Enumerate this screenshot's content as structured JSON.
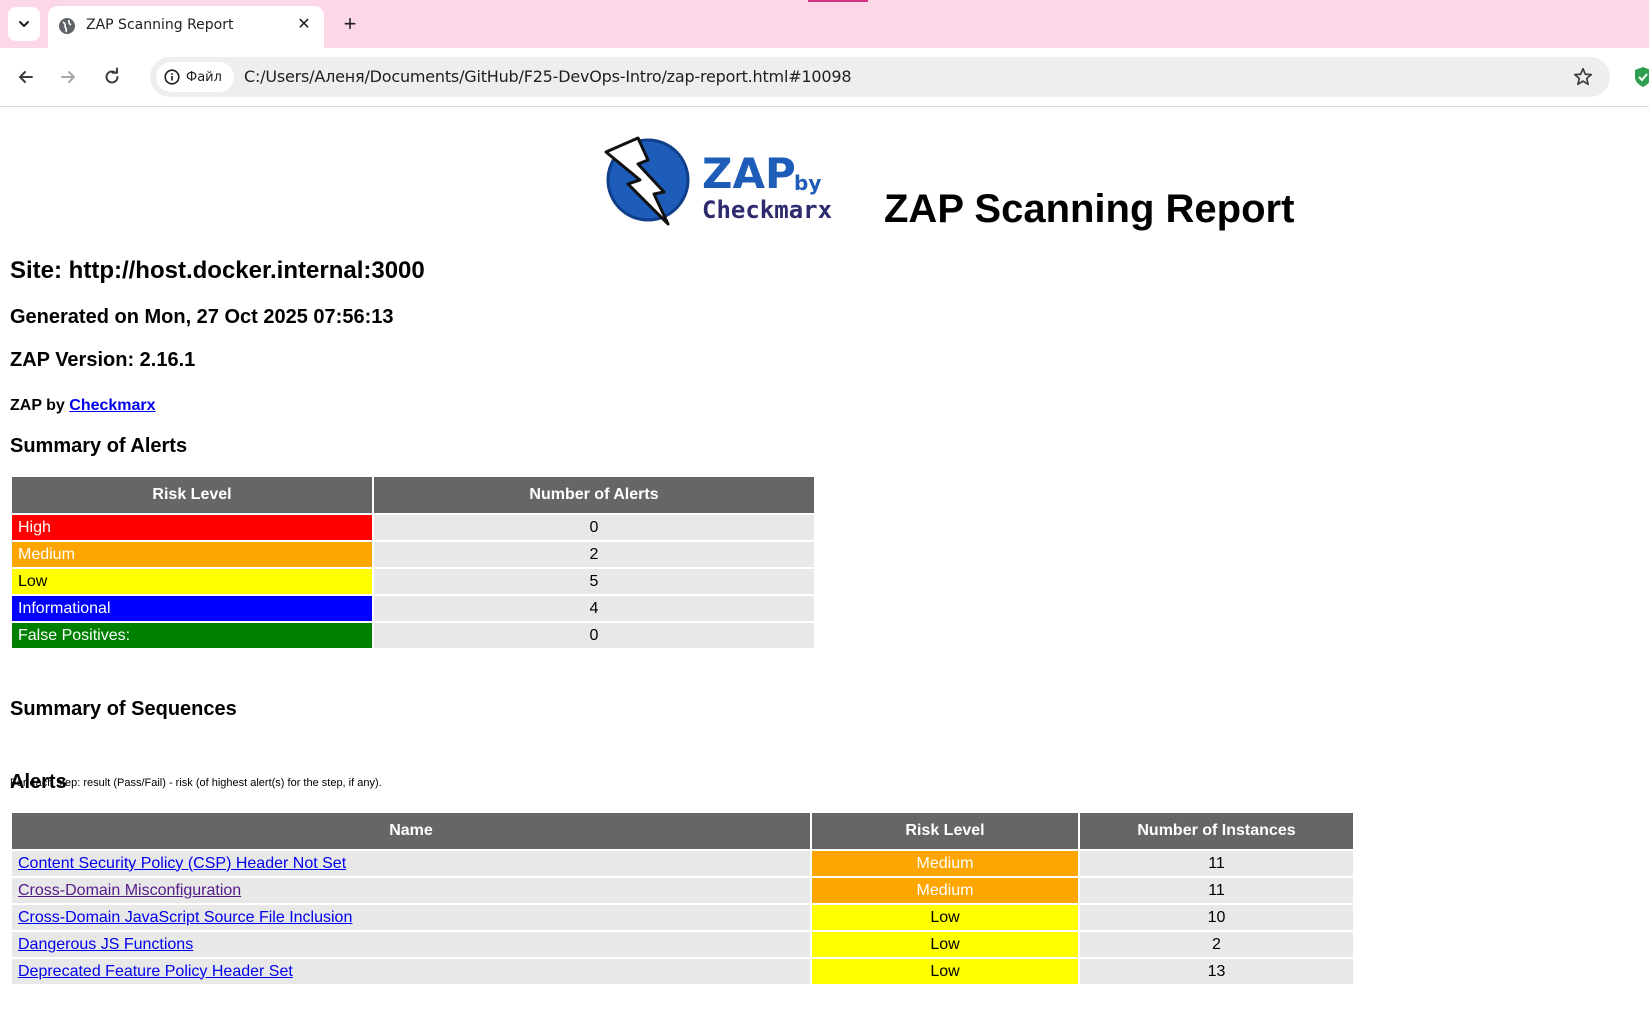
{
  "browser": {
    "tab_title": "ZAP Scanning Report",
    "site_chip_label": "Файл",
    "url": "C:/Users/Аленя/Documents/GitHub/F25-DevOps-Intro/zap-report.html#10098"
  },
  "logo": {
    "brand_main": "ZAP",
    "brand_by": "by",
    "brand_company": "Checkmarx"
  },
  "header": {
    "title": "ZAP Scanning Report",
    "site": "Site: http://host.docker.internal:3000",
    "generated": "Generated on Mon, 27 Oct 2025 07:56:13",
    "version": "ZAP Version: 2.16.1",
    "zap_by_prefix": "ZAP by ",
    "zap_by_link": "Checkmarx"
  },
  "summary_alerts": {
    "heading": "Summary of Alerts",
    "col_risk": "Risk Level",
    "col_count": "Number of Alerts",
    "rows": [
      {
        "label": "High",
        "count": "0",
        "color": "#ff0000"
      },
      {
        "label": "Medium",
        "count": "2",
        "color": "#ffa500"
      },
      {
        "label": "Low",
        "count": "5",
        "color": "#ffff00"
      },
      {
        "label": "Informational",
        "count": "4",
        "color": "#0000ff"
      },
      {
        "label": "False Positives:",
        "count": "0",
        "color": "#008000"
      }
    ]
  },
  "summary_sequences": {
    "heading": "Summary of Sequences",
    "note": "For each step: result (Pass/Fail) - risk (of highest alert(s) for the step, if any)."
  },
  "alerts": {
    "heading": "Alerts",
    "col_name": "Name",
    "col_risk": "Risk Level",
    "col_instances": "Number of Instances",
    "rows": [
      {
        "name": "Content Security Policy (CSP) Header Not Set",
        "risk": "Medium",
        "instances": "11"
      },
      {
        "name": "Cross-Domain Misconfiguration",
        "risk": "Medium",
        "instances": "11"
      },
      {
        "name": "Cross-Domain JavaScript Source File Inclusion",
        "risk": "Low",
        "instances": "10"
      },
      {
        "name": "Dangerous JS Functions",
        "risk": "Low",
        "instances": "2"
      },
      {
        "name": "Deprecated Feature Policy Header Set",
        "risk": "Low",
        "instances": "13"
      }
    ]
  },
  "colors": {
    "medium": "#ffa500",
    "low": "#ffff00",
    "header_bg": "#666666",
    "row_bg": "#e8e8e8",
    "tabbar_bg": "#fbd7e8"
  }
}
